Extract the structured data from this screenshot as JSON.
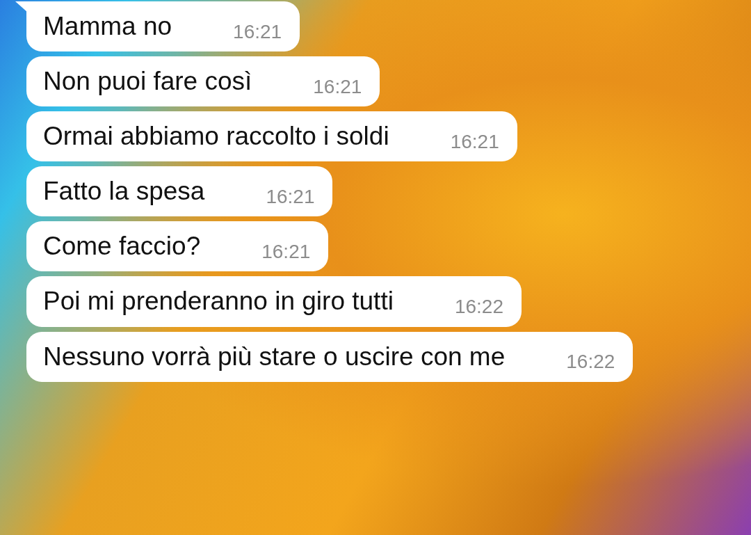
{
  "messages": [
    {
      "text": "Mamma no",
      "time": "16:21",
      "tail": true
    },
    {
      "text": "Non puoi fare così",
      "time": "16:21",
      "tail": false
    },
    {
      "text": "Ormai abbiamo raccolto i soldi",
      "time": "16:21",
      "tail": false
    },
    {
      "text": "Fatto la spesa",
      "time": "16:21",
      "tail": false
    },
    {
      "text": "Come faccio?",
      "time": "16:21",
      "tail": false
    },
    {
      "text": "Poi mi prenderanno in giro tutti",
      "time": "16:22",
      "tail": false
    },
    {
      "text": "Nessuno vorrà più stare o uscire con me",
      "time": "16:22",
      "tail": false
    }
  ]
}
